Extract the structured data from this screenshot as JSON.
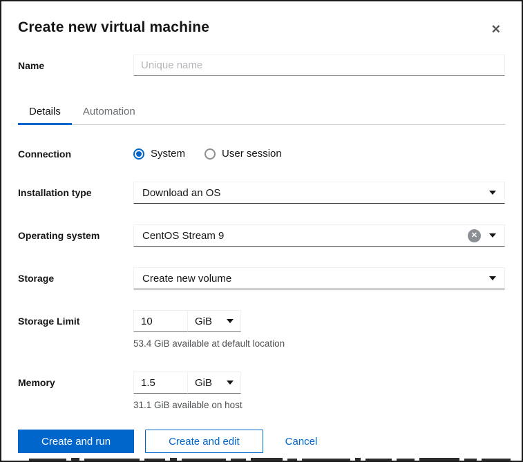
{
  "dialog": {
    "title": "Create new virtual machine"
  },
  "icons": {
    "close": "✕",
    "clear": "✕"
  },
  "tabs": [
    {
      "label": "Details",
      "active": true
    },
    {
      "label": "Automation",
      "active": false
    }
  ],
  "fields": {
    "name": {
      "label": "Name",
      "value": "",
      "placeholder": "Unique name"
    },
    "connection": {
      "label": "Connection",
      "options": [
        {
          "label": "System",
          "selected": true
        },
        {
          "label": "User session",
          "selected": false
        }
      ]
    },
    "installation_type": {
      "label": "Installation type",
      "value": "Download an OS"
    },
    "operating_system": {
      "label": "Operating system",
      "value": "CentOS Stream 9",
      "clearable": true
    },
    "storage": {
      "label": "Storage",
      "value": "Create new volume"
    },
    "storage_limit": {
      "label": "Storage Limit",
      "value": "10",
      "unit": "GiB",
      "helper": "53.4 GiB available at default location"
    },
    "memory": {
      "label": "Memory",
      "value": "1.5",
      "unit": "GiB",
      "helper": "31.1 GiB available on host"
    }
  },
  "footer": {
    "create_and_run": "Create and run",
    "create_and_edit": "Create and edit",
    "cancel": "Cancel"
  },
  "colors": {
    "primary": "#0066cc",
    "text": "#151515",
    "muted_text": "#6a6e73",
    "helper_text": "#4f5255",
    "input_border_bottom": "#8a8d90"
  }
}
